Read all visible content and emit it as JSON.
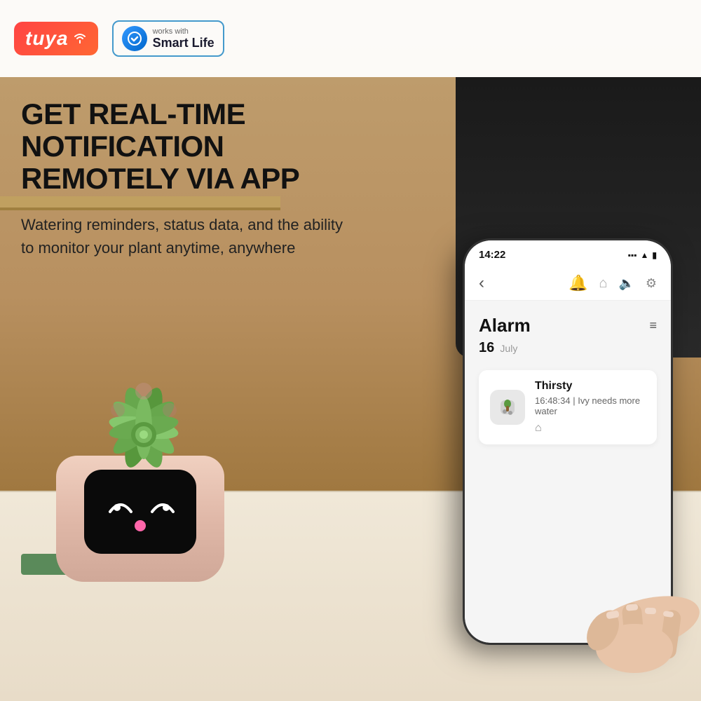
{
  "header": {
    "tuya_brand": "tuya",
    "works_with": "works with",
    "smart_life": "Smart Life"
  },
  "headline": {
    "line1": "GET REAL-TIME NOTIFICATION",
    "line2": "REMOTELY VIA APP"
  },
  "subtext": "Watering reminders, status data, and the ability to monitor your plant anytime, anywhere",
  "phone": {
    "status_time": "14:22",
    "status_icons": "▪▪ ▲ ▮",
    "nav_back": "‹",
    "section_title": "Alarm",
    "date_num": "16",
    "date_month": "July",
    "filter_icon": "≡",
    "notification": {
      "title": "Thirsty",
      "description": "16:48:34 | Ivy needs more water",
      "home_icon": "⌂"
    }
  }
}
